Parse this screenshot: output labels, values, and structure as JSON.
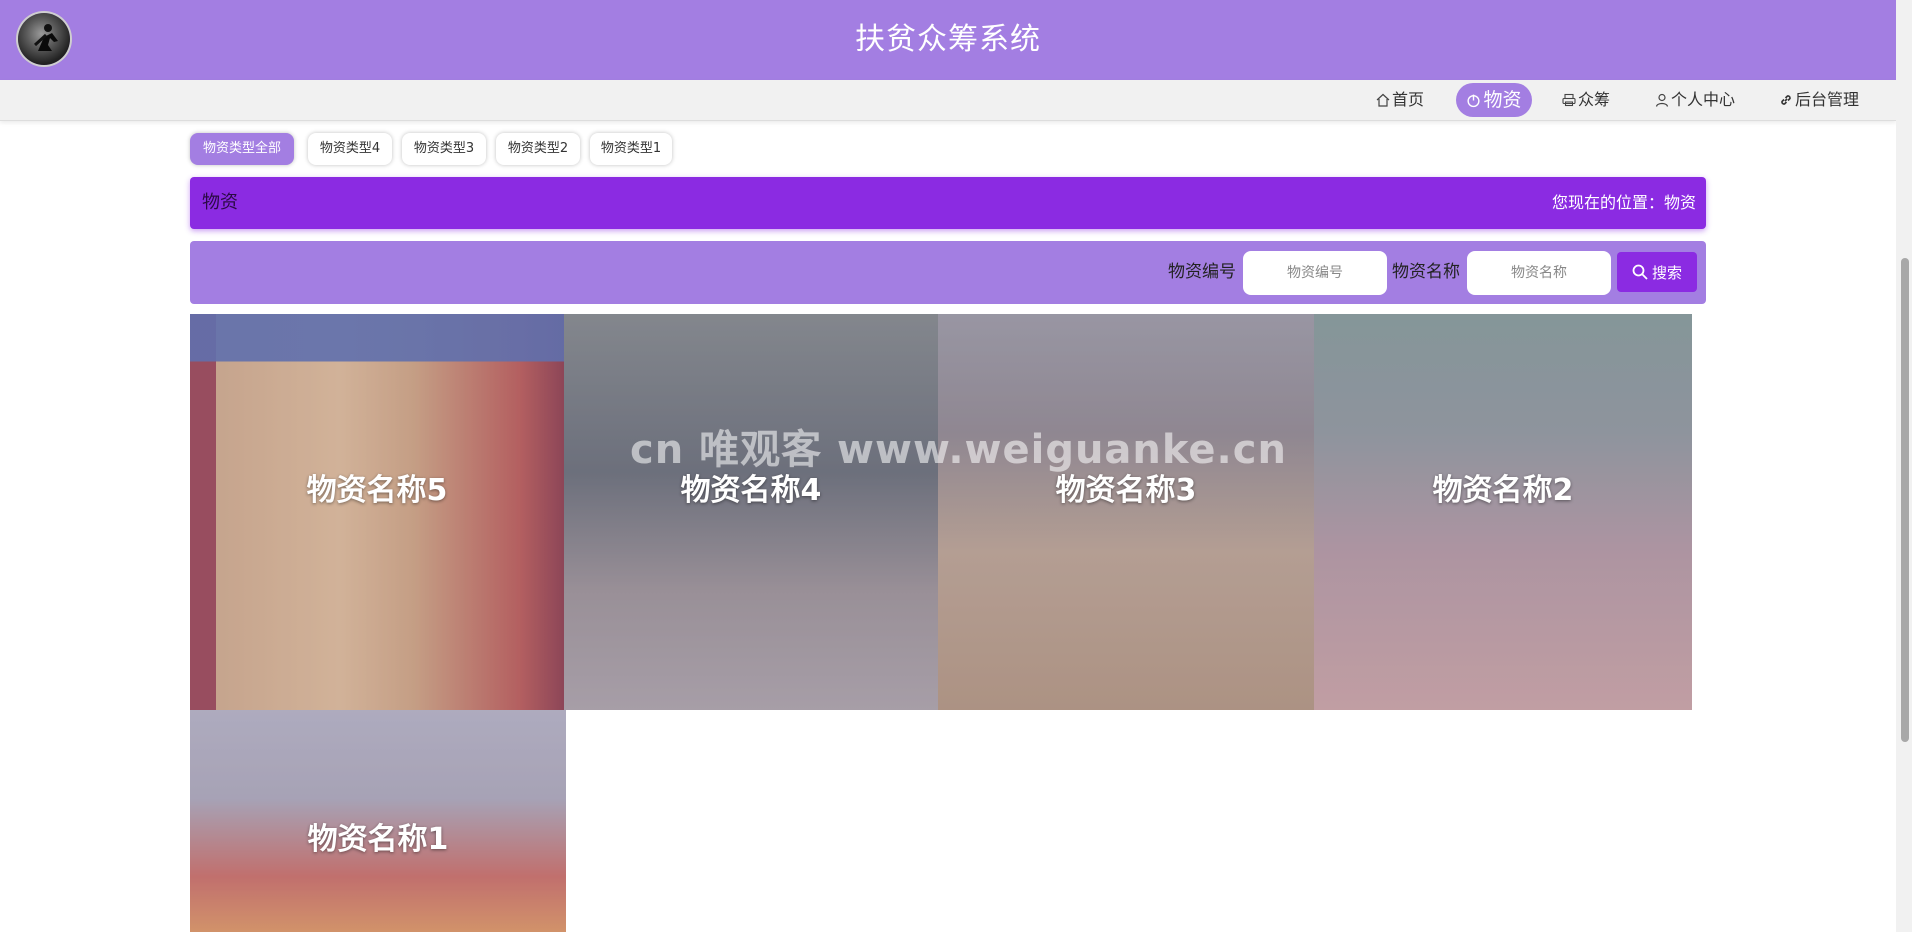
{
  "header": {
    "title": "扶贫众筹系统"
  },
  "nav": {
    "items": [
      {
        "label": "首页",
        "icon": "home-icon"
      },
      {
        "label": "物资",
        "icon": "power-icon"
      },
      {
        "label": "众筹",
        "icon": "print-icon"
      },
      {
        "label": "个人中心",
        "icon": "user-icon"
      },
      {
        "label": "后台管理",
        "icon": "link-icon"
      }
    ],
    "active": "物资"
  },
  "types": {
    "items": [
      "物资类型全部",
      "物资类型4",
      "物资类型3",
      "物资类型2",
      "物资类型1"
    ],
    "active": "物资类型全部"
  },
  "title_bar": {
    "left": "物资",
    "right": "您现在的位置：物资"
  },
  "search": {
    "code_label": "物资编号",
    "code_placeholder": "物资编号",
    "name_label": "物资名称",
    "name_placeholder": "物资名称",
    "button_label": "搜索"
  },
  "cards": [
    {
      "name": "物资名称5"
    },
    {
      "name": "物资名称4"
    },
    {
      "name": "物资名称3"
    },
    {
      "name": "物资名称2"
    },
    {
      "name": "物资名称1"
    }
  ],
  "watermark": "cn 唯观客 www.weiguanke.cn",
  "colors": {
    "primary": "#a37ee2",
    "accent": "#8b2be2",
    "nav_bg": "#f1f1f1"
  }
}
